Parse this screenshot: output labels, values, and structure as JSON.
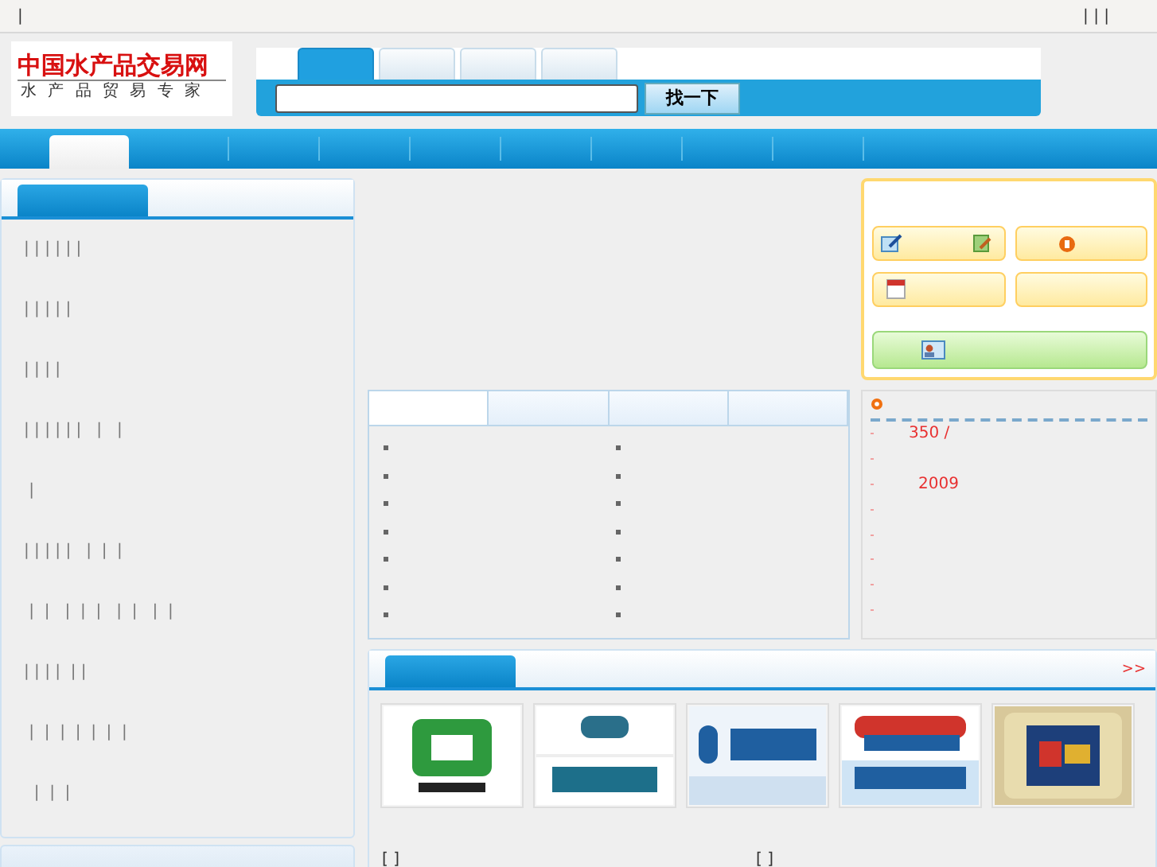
{
  "top_bar": {
    "left": "|",
    "right": "| | |"
  },
  "logo": {
    "title": "中国水产品交易网",
    "subtitle": "水 产 品 贸 易 专 家"
  },
  "search": {
    "tabs": [
      {
        "selected": true
      },
      {
        "selected": false
      },
      {
        "selected": false
      },
      {
        "selected": false
      }
    ],
    "button": "找一下"
  },
  "nav": [
    {
      "selected": true
    },
    {
      "selected": false
    },
    {
      "selected": false
    },
    {
      "selected": false
    },
    {
      "selected": false
    },
    {
      "selected": false
    },
    {
      "selected": false
    },
    {
      "selected": false
    },
    {
      "selected": false
    }
  ],
  "sidebar": {
    "items": [
      "| | | | | |",
      "| | | | |",
      "| | | |",
      "| | | | | |   |   |",
      " |",
      "| | | | |   |  |  |",
      " |  |   |  |  |   |  |   |  |",
      "| | | |  | |",
      " |  |  |  |  |  |  |",
      "  |  |  |"
    ]
  },
  "info_tabs": [
    {
      "selected": true
    },
    {
      "selected": false
    },
    {
      "selected": false
    },
    {
      "selected": false
    }
  ],
  "quick_buttons": [
    {
      "kind": "edit"
    },
    {
      "kind": "coin"
    },
    {
      "kind": "calendar"
    },
    {
      "kind": "plain"
    },
    {
      "kind": "card"
    }
  ],
  "news": [
    {
      "kind": "link",
      "text": "350 /"
    },
    {
      "kind": "blank"
    },
    {
      "kind": "link",
      "text": "2009"
    },
    {
      "kind": "blank"
    },
    {
      "kind": "blank"
    },
    {
      "kind": "blank"
    },
    {
      "kind": "blank"
    },
    {
      "kind": "blank"
    }
  ],
  "brands": {
    "more": ">>",
    "footer": [
      "[ ]",
      "[ ]"
    ]
  }
}
